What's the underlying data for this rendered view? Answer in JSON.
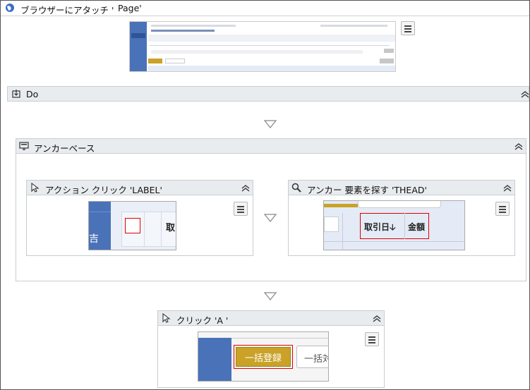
{
  "attach": {
    "title": "ブラウザーにアタッチ '",
    "page_label": "Page'"
  },
  "do_block": {
    "title": "Do"
  },
  "anchor_base": {
    "title": "アンカーベース"
  },
  "action_click": {
    "title": "アクション クリック 'LABEL'",
    "thumb_text_left": "吉",
    "thumb_text_right": "取"
  },
  "anchor_find": {
    "title": "アンカー 要素を探す 'THEAD'",
    "col1": "取引日🡣",
    "col2": "金額"
  },
  "click_a": {
    "title": "クリック 'A '",
    "btn_primary": "一括登録",
    "btn_secondary": "一括対"
  },
  "colors": {
    "header_bg": "#e9ecef",
    "border": "#c8ccd0",
    "selection_red": "#d00000",
    "nav_blue": "#4a72b8",
    "gold": "#c9a227"
  }
}
